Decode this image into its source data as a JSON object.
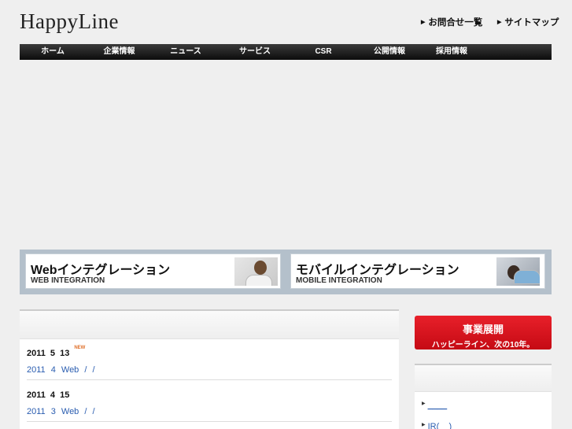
{
  "header": {
    "logo": "HappyLine",
    "util_links": [
      {
        "label": "お問合せ一覧",
        "icon": "triangle-right-icon"
      },
      {
        "label": "サイトマップ",
        "icon": "triangle-right-icon"
      }
    ]
  },
  "nav": {
    "items": [
      {
        "label": "ホーム"
      },
      {
        "label": "企業情報"
      },
      {
        "label": "ニュース"
      },
      {
        "label": "サービス"
      },
      {
        "label": "CSR"
      },
      {
        "label": "公開情報"
      },
      {
        "label": "採用情報"
      }
    ]
  },
  "banners": [
    {
      "title": "Webインテグレーション",
      "subtitle": "WEB INTEGRATION"
    },
    {
      "title": "モバイルインテグレーション",
      "subtitle": "MOBILE INTEGRATION"
    }
  ],
  "news": {
    "items": [
      {
        "date": "2011 5 13",
        "badge": "NEW",
        "text": "2011 4 Web / /"
      },
      {
        "date": "2011 4 15",
        "badge": "",
        "text": "2011 3 Web / /"
      }
    ]
  },
  "biz_banner": {
    "title": "事業展開",
    "subtitle": "ハッピーライン、次の10年。"
  },
  "side": {
    "links": [
      {
        "label": "____",
        "icon": "triangle-right-icon"
      },
      {
        "label": "IR(__)",
        "icon": "triangle-right-icon"
      }
    ]
  },
  "colors": {
    "nav_bg": "#111111",
    "link": "#2a5db0",
    "accent_red": "#d7121c",
    "banner_frame": "#b4c0cb"
  }
}
